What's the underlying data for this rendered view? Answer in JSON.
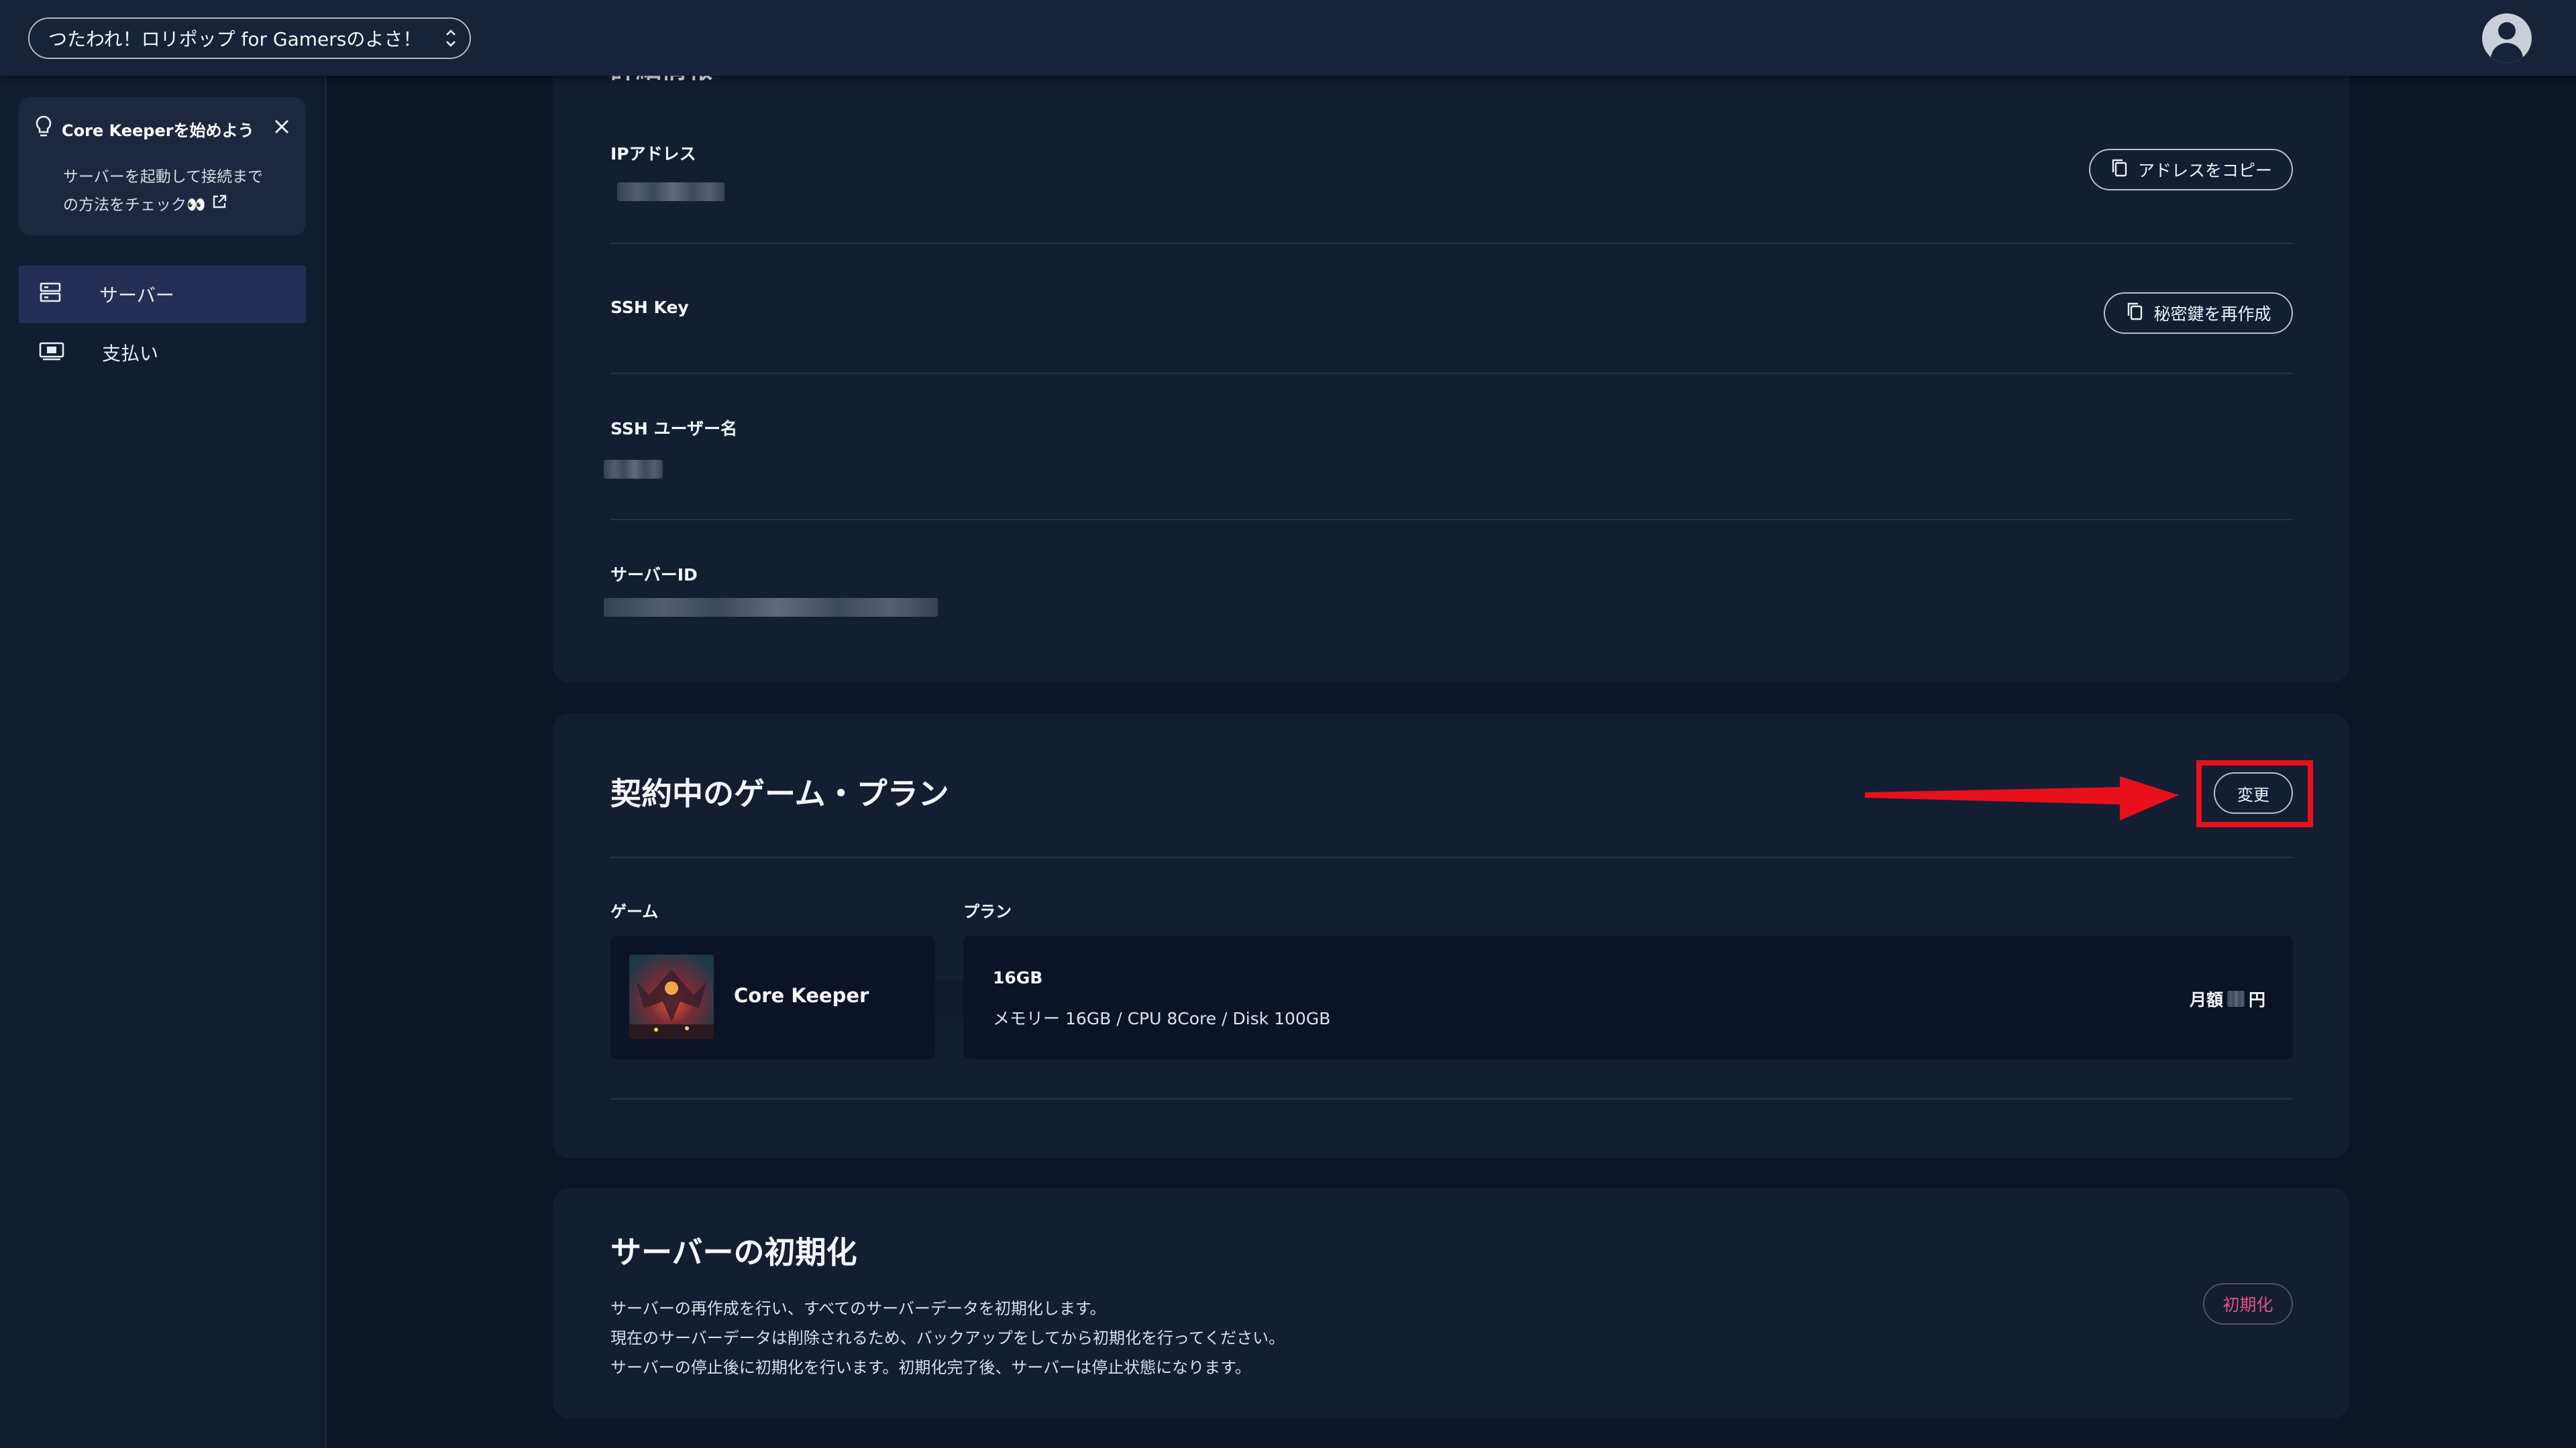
{
  "header": {
    "workspace_label": "つたわれ！ロリポップ for Gamersのよさ！",
    "avatar_icon": "user-avatar-icon"
  },
  "sidebar": {
    "tip": {
      "title": "Core Keeperを始めよう",
      "body_line1": "サーバーを起動して接続まで",
      "body_line2": "の方法をチェック👀",
      "icon": "lightbulb-icon"
    },
    "items": [
      {
        "label": "サーバー",
        "icon": "server-icon",
        "active": true
      },
      {
        "label": "支払い",
        "icon": "payment-icon",
        "active": false
      }
    ]
  },
  "details": {
    "partial_heading": "詳細情報",
    "ip_label": "IPアドレス",
    "copy_address_button": "アドレスをコピー",
    "ssh_key_label": "SSH Key",
    "regenerate_key_button": "秘密鍵を再作成",
    "ssh_user_label": "SSH ユーザー名",
    "server_id_label": "サーバーID"
  },
  "plan": {
    "title": "契約中のゲーム・プラン",
    "change_button": "変更",
    "game_header": "ゲーム",
    "plan_header": "プラン",
    "game_name": "Core Keeper",
    "plan_name": "16GB",
    "plan_spec": "メモリー 16GB / CPU 8Core / Disk 100GB",
    "price_prefix": "月額",
    "price_suffix": "円"
  },
  "init": {
    "title": "サーバーの初期化",
    "line1": "サーバーの再作成を行い、すべてのサーバーデータを初期化します。",
    "line2": "現在のサーバーデータは削除されるため、バックアップをしてから初期化を行ってください。",
    "line3": "サーバーの停止後に初期化を行います。初期化完了後、サーバーは停止状態になります。",
    "button": "初期化"
  },
  "colors": {
    "accent_red": "#e8101a",
    "danger_pink": "#e0527f",
    "active_nav": "#262e55"
  }
}
